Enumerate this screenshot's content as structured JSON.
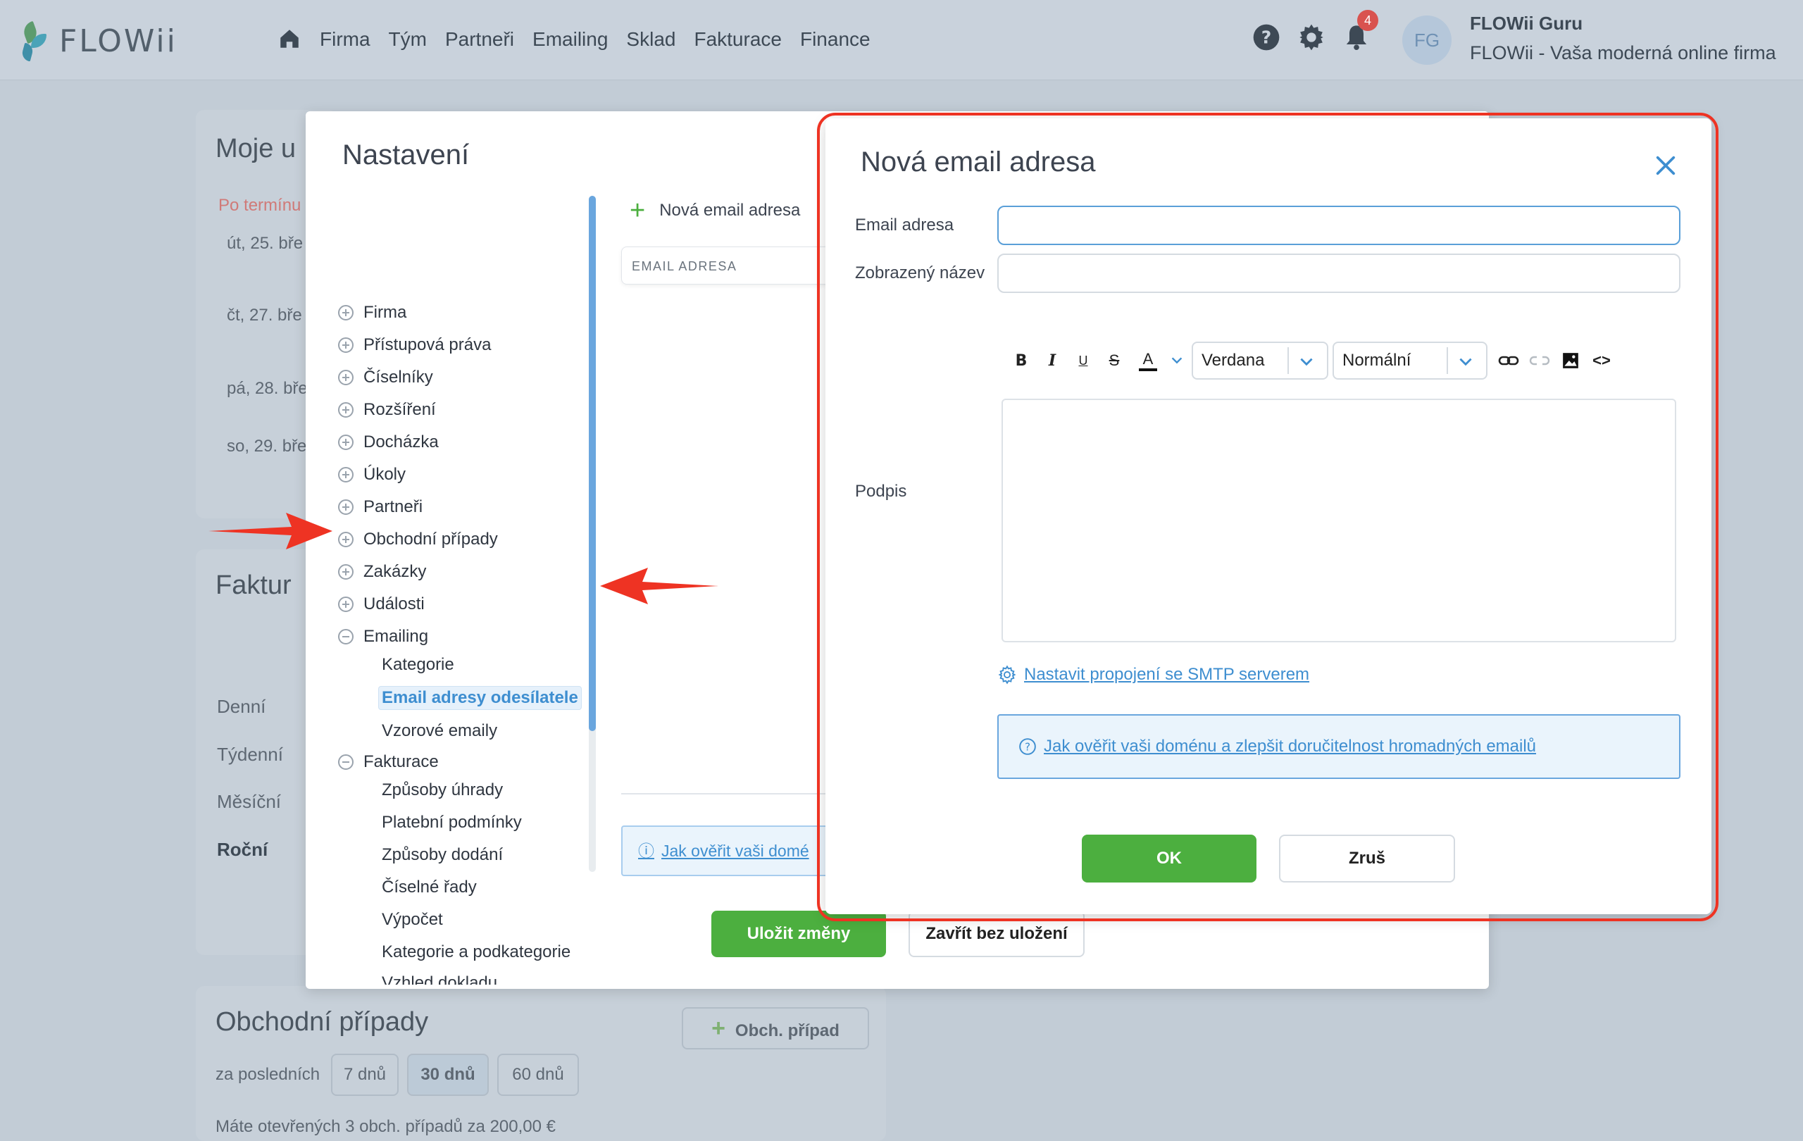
{
  "app": {
    "logo_text": "FLOWii",
    "nav": [
      "Firma",
      "Tým",
      "Partneři",
      "Emailing",
      "Sklad",
      "Fakturace",
      "Finance"
    ],
    "notification_count": "4",
    "avatar_initials": "FG",
    "user_name": "FLOWii Guru",
    "user_company": "FLOWii - Vaša moderná online firma"
  },
  "dashboard": {
    "tasks_title": "Moje u",
    "tasks_tab": "Po termínu",
    "task_dates": [
      "út, 25. bře",
      "čt, 27. bře",
      "pá, 28. bře",
      "so, 29. bře"
    ],
    "invoices_title": "Faktur",
    "periods": [
      "Denní",
      "Týdenní",
      "Měsíční",
      "Roční"
    ],
    "deals_title": "Obchodní případy",
    "deals_button": "Obch. případ",
    "deals_period_label": "za posledních",
    "deals_periods": [
      "7 dnů",
      "30 dnů",
      "60 dnů"
    ],
    "deals_note": "Máte otevřených 3 obch. případů za 200,00 €"
  },
  "settings": {
    "title": "Nastavení",
    "tree": {
      "firma": "Firma",
      "pristupova": "Přístupová práva",
      "ciselniky": "Číselníky",
      "rozsireni": "Rozšíření",
      "dochazka": "Docházka",
      "ukoly": "Úkoly",
      "partneri": "Partneři",
      "obchodni": "Obchodní případy",
      "zakazky": "Zakázky",
      "udalosti": "Události",
      "emailing": "Emailing",
      "kategorie": "Kategorie",
      "email_adresy": "Email adresy odesílatele",
      "vzorove": "Vzorové emaily",
      "fakturace": "Fakturace",
      "zpusoby_uhrady": "Způsoby úhrady",
      "platebni": "Platební podmínky",
      "zpusoby_dodani": "Způsoby dodání",
      "ciselne_rady": "Číselné řady",
      "vypocet": "Výpočet",
      "kategorie_pod": "Kategorie a podkategorie",
      "vzhled": "Vzhled dokladu"
    },
    "new_email_link": "Nová email adresa",
    "column_header": "EMAIL ADRESA",
    "info_link": "Jak ověřit vaši domé",
    "save_button": "Uložit změny",
    "close_button": "Zavřít bez uložení"
  },
  "dialog": {
    "title": "Nová email adresa",
    "email_label": "Email adresa",
    "display_name_label": "Zobrazený název",
    "signature_label": "Podpis",
    "font_select": "Verdana",
    "size_select": "Normální",
    "smtp_link": "Nastavit propojení se SMTP serverem",
    "info_link": "Jak ověřit vaši doménu a zlepšit doručitelnost hromadných emailů",
    "ok_button": "OK",
    "cancel_button": "Zruš"
  },
  "colors": {
    "accent": "#3e8ed0",
    "primary_green": "#4caf3f",
    "annotation_red": "#ee3323"
  }
}
